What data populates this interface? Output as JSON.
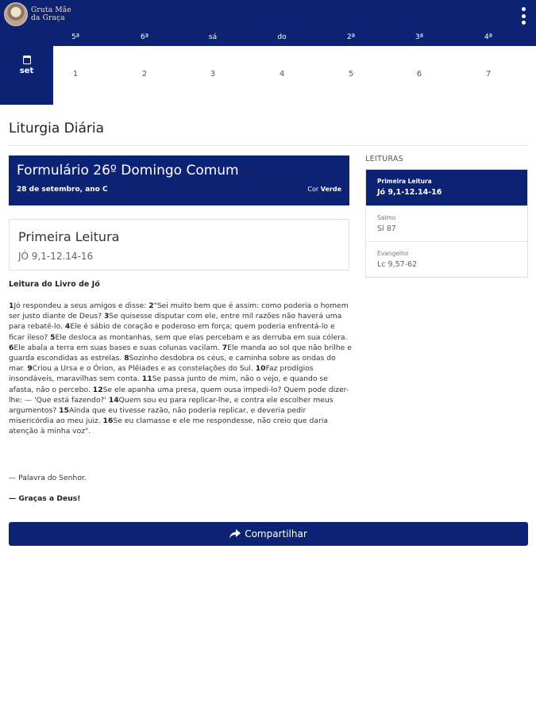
{
  "app": {
    "logo_line1": "Gruta Mãe",
    "logo_line2": "da Graça"
  },
  "calendar": {
    "month": "set",
    "days": [
      {
        "name": "5ª",
        "num": "1"
      },
      {
        "name": "6ª",
        "num": "2"
      },
      {
        "name": "sá",
        "num": "3"
      },
      {
        "name": "do",
        "num": "4"
      },
      {
        "name": "2ª",
        "num": "5"
      },
      {
        "name": "3ª",
        "num": "6"
      },
      {
        "name": "4ª",
        "num": "7"
      }
    ]
  },
  "page": {
    "title": "Liturgia Diária"
  },
  "formulario": {
    "title": "Formulário 26º Domingo Comum",
    "date": "28 de setembro, ano C",
    "cor_label": "Cor",
    "cor_value": "Verde"
  },
  "leitura": {
    "title": "Primeira Leitura",
    "reference": "JÓ 9,1-12.14-16",
    "heading": "Leitura do Livro de Jó",
    "verses": [
      {
        "n": "1",
        "t": "Jó respondeu a seus amigos e disse: "
      },
      {
        "n": "2",
        "t": "\"Sei muito bem que é assim: como poderia o homem ser justo diante de Deus? "
      },
      {
        "n": "3",
        "t": "Se quisesse disputar com ele, entre mil razões não haverá uma para rebatê-lo. "
      },
      {
        "n": "4",
        "t": "Ele é sábio de coração e poderoso em força; quem poderia enfrentá-lo e ficar ileso? "
      },
      {
        "n": "5",
        "t": "Ele desloca as montanhas, sem que elas percebam e as derruba em sua cólera. "
      },
      {
        "n": "6",
        "t": "Ele abala a terra em suas bases e suas colunas vacilam. "
      },
      {
        "n": "7",
        "t": "Ele manda ao sol que não brilhe e guarda escondidas as estrelas. "
      },
      {
        "n": "8",
        "t": "Sozinho desdobra os céus, e caminha sobre as ondas do mar. "
      },
      {
        "n": "9",
        "t": "Criou a Ursa e o Órion, as Plêiades e as constelações do Sul. "
      },
      {
        "n": "10",
        "t": "Faz prodígios insondáveis, maravilhas sem conta. "
      },
      {
        "n": "11",
        "t": "Se passa junto de mim, não o vejo, e quando se afasta, não o percebo. "
      },
      {
        "n": "12",
        "t": "Se ele apanha uma presa, quem ousa impedi-lo? Quem pode dizer-lhe: — 'Que está fazendo?' "
      },
      {
        "n": "14",
        "t": "Quem sou eu para replicar-lhe, e contra ele escolher meus argumentos? "
      },
      {
        "n": "15",
        "t": "Ainda que eu tivesse razão, não poderia replicar, e deveria pedir misericórdia ao meu juiz. "
      },
      {
        "n": "16",
        "t": "Se eu clamasse e ele me respondesse, não creio que daria atenção à minha voz\"."
      }
    ],
    "palavra": "— Palavra do Senhor.",
    "resposta": "— Graças a Deus!"
  },
  "share": {
    "label": "Compartilhar"
  },
  "sidebar": {
    "header": "LEITURAS",
    "items": [
      {
        "label": "Primeira Leitura",
        "ref": "Jó 9,1-12.14-16",
        "active": true
      },
      {
        "label": "Salmo",
        "ref": "Sl 87",
        "active": false
      },
      {
        "label": "Evangelho",
        "ref": "Lc 9,57-62",
        "active": false
      }
    ]
  },
  "colors": {
    "primary": "#0c2272",
    "background": "#ffffff"
  },
  "icons": {
    "menu": "kebab-menu-icon",
    "calendar": "calendar-icon",
    "share": "share-arrow-icon"
  }
}
